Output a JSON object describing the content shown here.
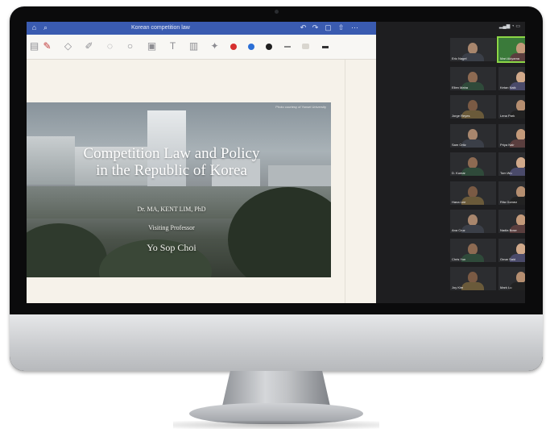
{
  "app": {
    "title": "Korean competition law"
  },
  "toolbar": {
    "colors": [
      "#d62f2f",
      "#2b6fd6",
      "#202020"
    ],
    "tools": [
      "pen-icon",
      "eraser-icon",
      "highlighter-icon",
      "lasso-icon",
      "shape-icon",
      "image-icon",
      "text-icon",
      "laser-icon"
    ]
  },
  "slide": {
    "credit": "Photo courtesy of Yonsei University",
    "title_line1": "Competition Law and Policy",
    "title_line2": "in the Republic of Korea",
    "line1": "Dr. MA, KENT LIM, PhD",
    "line2": "Visiting Professor",
    "presenter": "Yo Sop Choi"
  },
  "gallery": {
    "participants": [
      {
        "name": "Eric Nagel"
      },
      {
        "name": "Mari Akiyama"
      },
      {
        "name": "Ellen Maha"
      },
      {
        "name": "Ketan Naik"
      },
      {
        "name": "Jorge Reyes"
      },
      {
        "name": "Lena Park"
      },
      {
        "name": "Sam Ortiz"
      },
      {
        "name": "Priya Nair"
      },
      {
        "name": "D. Kumar"
      },
      {
        "name": "Tom Wu"
      },
      {
        "name": "Hana Lee"
      },
      {
        "name": "Rita Gomez"
      },
      {
        "name": "Ana Cruz"
      },
      {
        "name": "Nadia Bose"
      },
      {
        "name": "Chris Yun"
      },
      {
        "name": "Omar Said"
      },
      {
        "name": "Joy Kim"
      },
      {
        "name": "Mark Lu"
      }
    ]
  }
}
